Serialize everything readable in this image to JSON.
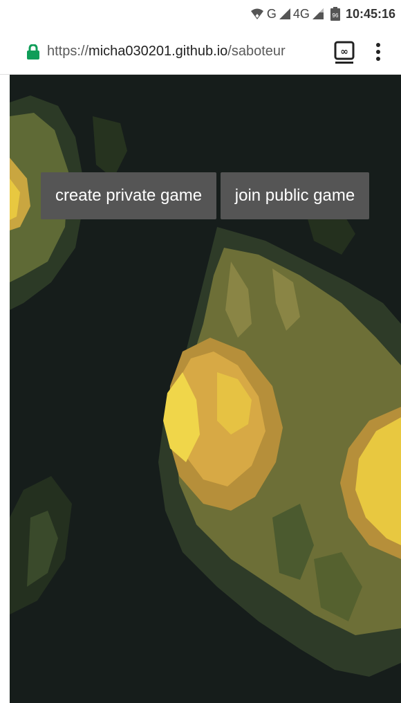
{
  "status_bar": {
    "network_label": "G",
    "network_type": "4G",
    "battery_level": "96",
    "time": "10:45:16",
    "icons": [
      "wifi-icon",
      "signal-icon",
      "signal-icon",
      "battery-icon"
    ]
  },
  "browser": {
    "url_scheme": "https://",
    "url_host": "micha030201.github.io",
    "url_path": "/saboteur",
    "secure_color": "#0f9d58",
    "icons": [
      "lock-icon",
      "tab-switcher-icon",
      "overflow-menu-icon"
    ]
  },
  "game": {
    "create_button_label": "create private game",
    "join_button_label": "join public game",
    "background": "pixel-art cave with glowing gold crystals",
    "colors": {
      "dark": "#161d1b",
      "moss": "#3b4a2c",
      "olive": "#777a3c",
      "ochre": "#b89a3e",
      "gold": "#e8c840",
      "button": "#555555"
    }
  }
}
